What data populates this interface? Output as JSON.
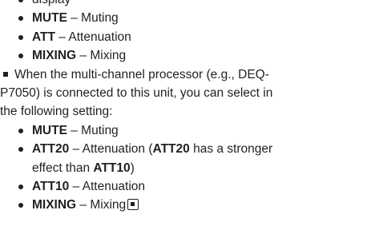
{
  "top_partial": "display",
  "list1": [
    {
      "term": "MUTE",
      "sep": " – ",
      "desc": "Muting"
    },
    {
      "term": "ATT",
      "sep": " – ",
      "desc": "Attenuation"
    },
    {
      "term": "MIXING",
      "sep": " – ",
      "desc": "Mixing"
    }
  ],
  "note": {
    "line1": "When the multi-channel processor (e.g., DEQ-",
    "line2": "P7050) is connected to this unit, you can select in",
    "line3": "the following setting:"
  },
  "list2": {
    "item1": {
      "term": "MUTE",
      "sep": " – ",
      "desc": "Muting"
    },
    "item2": {
      "term": "ATT20",
      "sep": " – ",
      "desc_a": "Attenuation (",
      "term_b": "ATT20",
      "desc_b": " has a stronger",
      "cont": "effect than ",
      "term_c": "ATT10",
      "cont_end": ")"
    },
    "item3": {
      "term": "ATT10",
      "sep": " – ",
      "desc": "Attenuation"
    },
    "item4": {
      "term": "MIXING",
      "sep": " – ",
      "desc": "Mixing"
    }
  },
  "icons": {
    "note_bullet": "square-bullet-icon",
    "end": "end-of-section-icon"
  }
}
